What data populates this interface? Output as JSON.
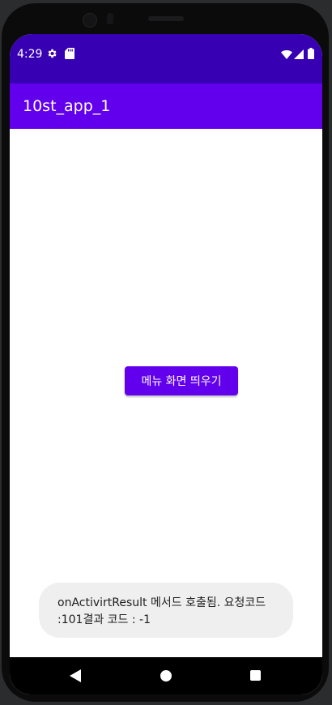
{
  "status_bar": {
    "time": "4:29",
    "background": "#3700b3",
    "icons": [
      "gear-icon",
      "sd-card-icon",
      "wifi-icon",
      "cell-signal-icon",
      "battery-icon"
    ]
  },
  "app_bar": {
    "title": "10st_app_1",
    "background": "#6200ee"
  },
  "main": {
    "menu_button_label": "메뉴 화면 띄우기",
    "accent": "#6200ee"
  },
  "toast": {
    "message": "onActivirtResult 메서드 호출됨. 요청코드 :101결과 코드 : -1",
    "background": "#efefef"
  },
  "nav_bar": {
    "icons": [
      "back-icon",
      "home-icon",
      "recents-icon"
    ]
  }
}
